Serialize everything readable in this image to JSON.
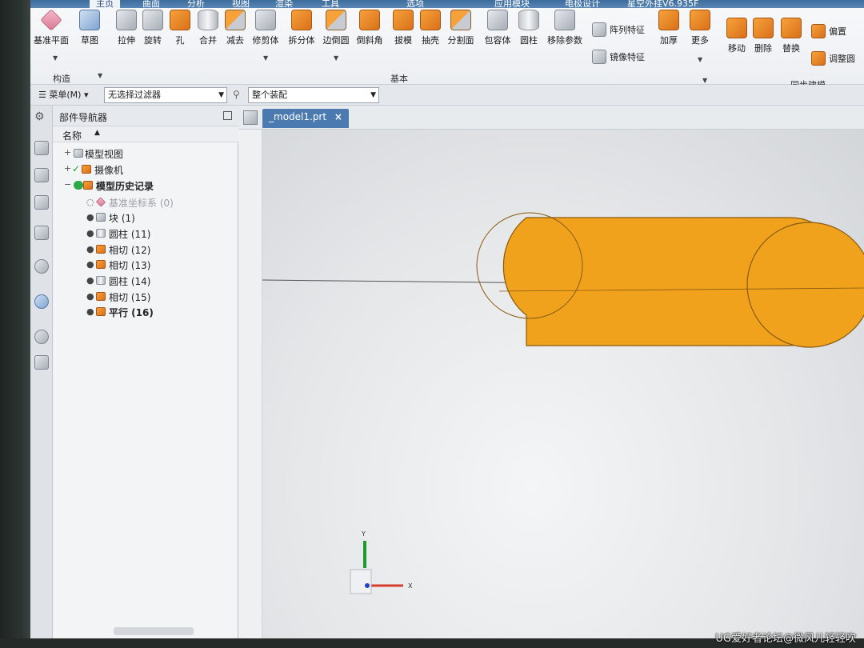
{
  "menu_tabs": [
    {
      "label": "主页",
      "active": true
    },
    {
      "label": "曲面"
    },
    {
      "label": "分析"
    },
    {
      "label": "视图"
    },
    {
      "label": "渲染"
    },
    {
      "label": "工具"
    },
    {
      "label": "选项"
    },
    {
      "label": "应用模块"
    },
    {
      "label": "电极设计"
    },
    {
      "label": "星空外挂V6.935F"
    }
  ],
  "ribbon": {
    "buttons": [
      {
        "label": "基准平面",
        "icon": "datum-plane-icon"
      },
      {
        "label": "草图",
        "icon": "sketch-icon"
      },
      {
        "label": "拉伸",
        "icon": "extrude-icon"
      },
      {
        "label": "旋转",
        "icon": "revolve-icon"
      },
      {
        "label": "孔",
        "icon": "hole-icon"
      },
      {
        "label": "合并",
        "icon": "unite-icon"
      },
      {
        "label": "减去",
        "icon": "subtract-icon"
      },
      {
        "label": "修剪体",
        "icon": "trim-body-icon"
      },
      {
        "label": "拆分体",
        "icon": "split-body-icon"
      },
      {
        "label": "边倒圆",
        "icon": "edge-blend-icon"
      },
      {
        "label": "倒斜角",
        "icon": "chamfer-icon"
      },
      {
        "label": "拔模",
        "icon": "draft-icon"
      },
      {
        "label": "抽壳",
        "icon": "shell-icon"
      },
      {
        "label": "分割面",
        "icon": "divide-face-icon"
      },
      {
        "label": "包容体",
        "icon": "bounding-body-icon"
      },
      {
        "label": "圆柱",
        "icon": "cylinder-icon"
      },
      {
        "label": "移除参数",
        "icon": "remove-parameters-icon"
      }
    ],
    "side_buttons": {
      "pattern": "阵列特征",
      "mirror": "镜像特征",
      "thicken": "加厚",
      "more": "更多"
    },
    "sync_buttons": [
      {
        "label": "移动",
        "icon": "move-face-icon"
      },
      {
        "label": "删除",
        "icon": "delete-face-icon"
      },
      {
        "label": "替换",
        "icon": "replace-face-icon"
      }
    ],
    "sync_side": {
      "offset": "偏置",
      "resize": "调整圆"
    },
    "groups": {
      "construct": "构造",
      "base": "基本",
      "sync": "同步建模"
    }
  },
  "toolbar": {
    "menu_label": "菜单(M)",
    "filter_value": "无选择过滤器",
    "scope_value": "整个装配"
  },
  "navigator": {
    "title": "部件导航器",
    "column_name": "名称",
    "items": [
      {
        "label": "模型视图"
      },
      {
        "label": "摄像机"
      },
      {
        "label": "模型历史记录"
      },
      {
        "label": "基准坐标系 (0)"
      },
      {
        "label": "块 (1)"
      },
      {
        "label": "圆柱 (11)"
      },
      {
        "label": "相切 (12)"
      },
      {
        "label": "相切 (13)"
      },
      {
        "label": "圆柱 (14)"
      },
      {
        "label": "相切 (15)"
      },
      {
        "label": "平行 (16)"
      }
    ]
  },
  "graphics": {
    "tab_label": "_model1.prt",
    "model_color": "#f0a21c",
    "axis_labels": {
      "y": "Y",
      "x": "X"
    }
  },
  "watermark": "UG爱好者论坛@微风儿轻轻吹"
}
